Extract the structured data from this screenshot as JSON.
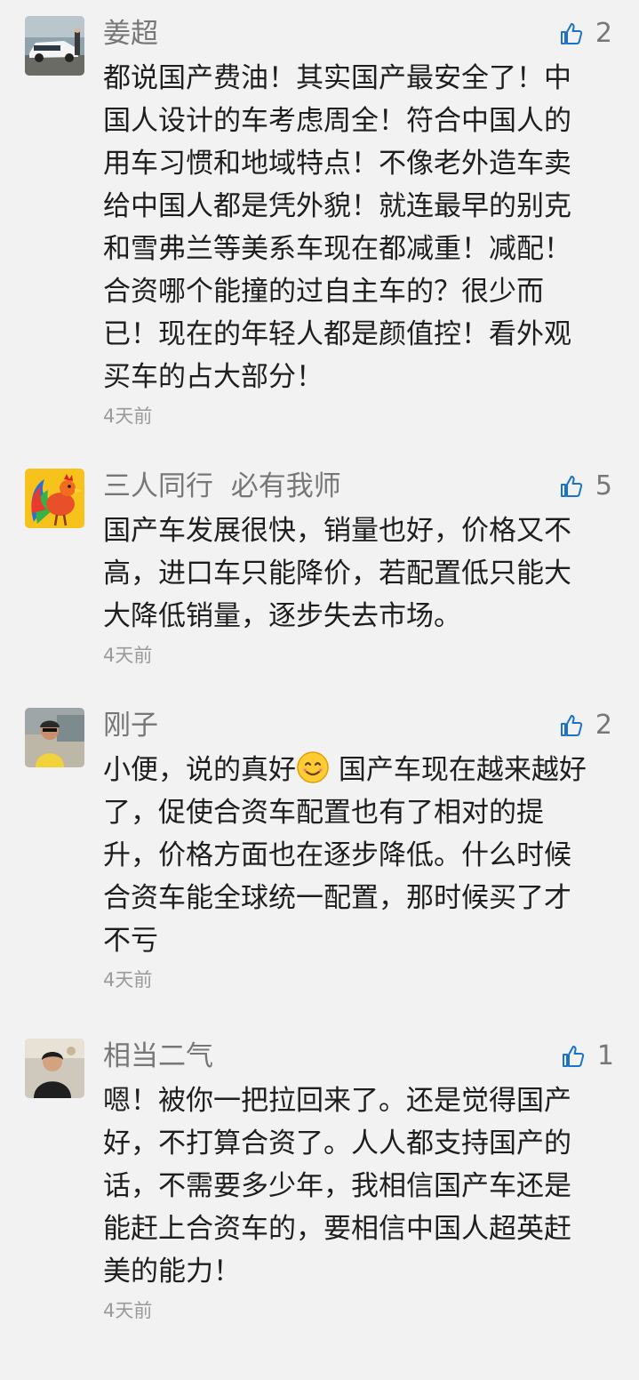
{
  "comments": [
    {
      "author": "姜超",
      "likes": "2",
      "text": "都说国产费油！其实国产最安全了！中国人设计的车考虑周全！符合中国人的用车习惯和地域特点！不像老外造车卖给中国人都是凭外貌！就连最早的别克和雪弗兰等美系车现在都减重！减配！合资哪个能撞的过自主车的？很少而已！现在的年轻人都是颜值控！看外观买车的占大部分！",
      "lines": [
        "都说国产费油！其实国产最安全了！中",
        "国人设计的车考虑周全！符合中国人的",
        "用车习惯和地域特点！不像老外造车卖",
        "给中国人都是凭外貌！就连最早的别克",
        "和雪弗兰等美系车现在都减重！减配！",
        "合资哪个能撞的过自主车的？很少而",
        "已！现在的年轻人都是颜值控！看外观",
        "买车的占大部分！"
      ],
      "time": "4天前",
      "avatar_icon": "car-photo-icon"
    },
    {
      "author": "三人同行  必有我师",
      "likes": "5",
      "text": "国产车发展很快，销量也好，价格又不高，进口车只能降价，若配置低只能大大降低销量，逐步失去市场。",
      "lines": [
        "国产车发展很快，销量也好，价格又不",
        "高，进口车只能降价，若配置低只能大",
        "大降低销量，逐步失去市场。"
      ],
      "time": "4天前",
      "avatar_icon": "rooster-icon"
    },
    {
      "author": "刚子",
      "likes": "2",
      "text_before_emoji": "小便，说的真好",
      "emoji": "smile-emoji-icon",
      "text_after_emoji": "国产车现在越来越好了，促使合资车配置也有了相对的提升，价格方面也在逐步降低。什么时候合资车能全球统一配置，那时候买了才不亏",
      "lines": [
        "了，促使合资车配置也有了相对的提",
        "升，价格方面也在逐步降低。什么时候",
        "合资车能全球统一配置，那时候买了才",
        "不亏"
      ],
      "first_line_after_emoji": " 国产车现在越来越好",
      "time": "4天前",
      "avatar_icon": "person-photo-icon"
    },
    {
      "author": "相当二气",
      "likes": "1",
      "text": "嗯！被你一把拉回来了。还是觉得国产好，不打算合资了。人人都支持国产的话，不需要多少年，我相信国产车还是能赶上合资车的，要相信中国人超英赶美的能力！",
      "lines": [
        "嗯！被你一把拉回来了。还是觉得国产",
        "好，不打算合资了。人人都支持国产的",
        "话，不需要多少年，我相信国产车还是",
        "能赶上合资车的，要相信中国人超英赶",
        "美的能力！"
      ],
      "time": "4天前",
      "avatar_icon": "person-photo-icon"
    }
  ],
  "like_icon": "thumbs-up-icon",
  "colors": {
    "background": "#f2f2f2",
    "author": "#777777",
    "body_text": "#1e1e1e",
    "time": "#9a9a9a",
    "like_icon": "#1a73c9"
  }
}
